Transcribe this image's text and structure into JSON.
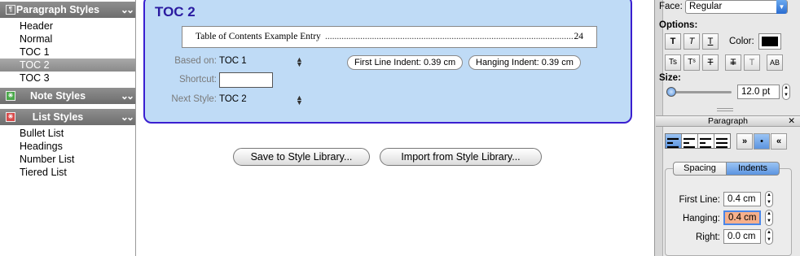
{
  "sidebar": {
    "paragraph_styles": {
      "title": "Paragraph Styles",
      "icon": "¶",
      "items": [
        "Header",
        "Normal",
        "TOC 1",
        "TOC 2",
        "TOC 3"
      ],
      "selected_index": 3
    },
    "note_styles": {
      "title": "Note Styles"
    },
    "list_styles": {
      "title": "List Styles",
      "items": [
        "Bullet List",
        "Headings",
        "Number List",
        "Tiered List"
      ]
    }
  },
  "style_panel": {
    "title": "TOC 2",
    "preview": {
      "entry": "Table of Contents Example Entry",
      "page": "24"
    },
    "based_on": {
      "label": "Based on:",
      "value": "TOC 1"
    },
    "shortcut": {
      "label": "Shortcut:",
      "value": ""
    },
    "next_style": {
      "label": "Next Style:",
      "value": "TOC 2"
    },
    "indent_badges": [
      "First Line Indent: 0.39 cm",
      "Hanging Indent: 0.39 cm"
    ]
  },
  "buttons": {
    "save": "Save to Style Library...",
    "import": "Import from Style Library..."
  },
  "inspector": {
    "face": {
      "label": "Face:",
      "value": "Regular"
    },
    "options_label": "Options:",
    "color_label": "Color:",
    "text_color": "#000000",
    "style_buttons": [
      "T",
      "T",
      "T"
    ],
    "effect_buttons": [
      "Ts",
      "Tˢ",
      "T",
      "T",
      "T",
      "AB"
    ],
    "size": {
      "label": "Size:",
      "value": "12.0 pt"
    },
    "paragraph_palette": {
      "title": "Paragraph",
      "tabs": [
        "Spacing",
        "Indents"
      ],
      "active_tab": "Indents"
    },
    "indents": {
      "first_line": {
        "label": "First Line:",
        "value": "0.4 cm"
      },
      "hanging": {
        "label": "Hanging:",
        "value": "0.4 cm"
      },
      "right": {
        "label": "Right:",
        "value": "0.0 cm"
      }
    },
    "flow_buttons": [
      "»",
      "•",
      "«"
    ]
  }
}
